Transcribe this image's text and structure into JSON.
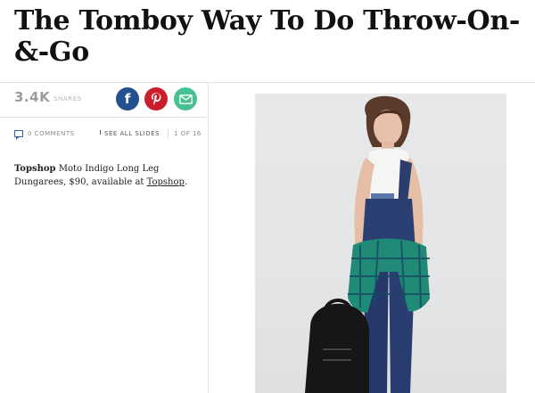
{
  "article": {
    "headline": "The Tomboy Way To Do Throw-On-&-Go"
  },
  "share": {
    "count": "3.4K",
    "label": "SHARES",
    "buttons": [
      {
        "name": "facebook",
        "glyph": "f",
        "color": "#23508f"
      },
      {
        "name": "pinterest",
        "glyph": "P",
        "color": "#cc1d2d"
      },
      {
        "name": "email",
        "glyph": "✉",
        "color": "#46c193"
      }
    ]
  },
  "meta": {
    "comments": "0 COMMENTS",
    "see_all": "SEE ALL SLIDES",
    "slide_count": "1 OF 16"
  },
  "caption": {
    "brand": "Topshop",
    "text": " Moto Indigo Long Leg Dungarees, $90, available at ",
    "link": "Topshop",
    "end": "."
  },
  "image": {
    "alt": "Model wearing indigo dungarees, white sleeveless top, plaid shirt tied at waist, holding black backpack"
  }
}
